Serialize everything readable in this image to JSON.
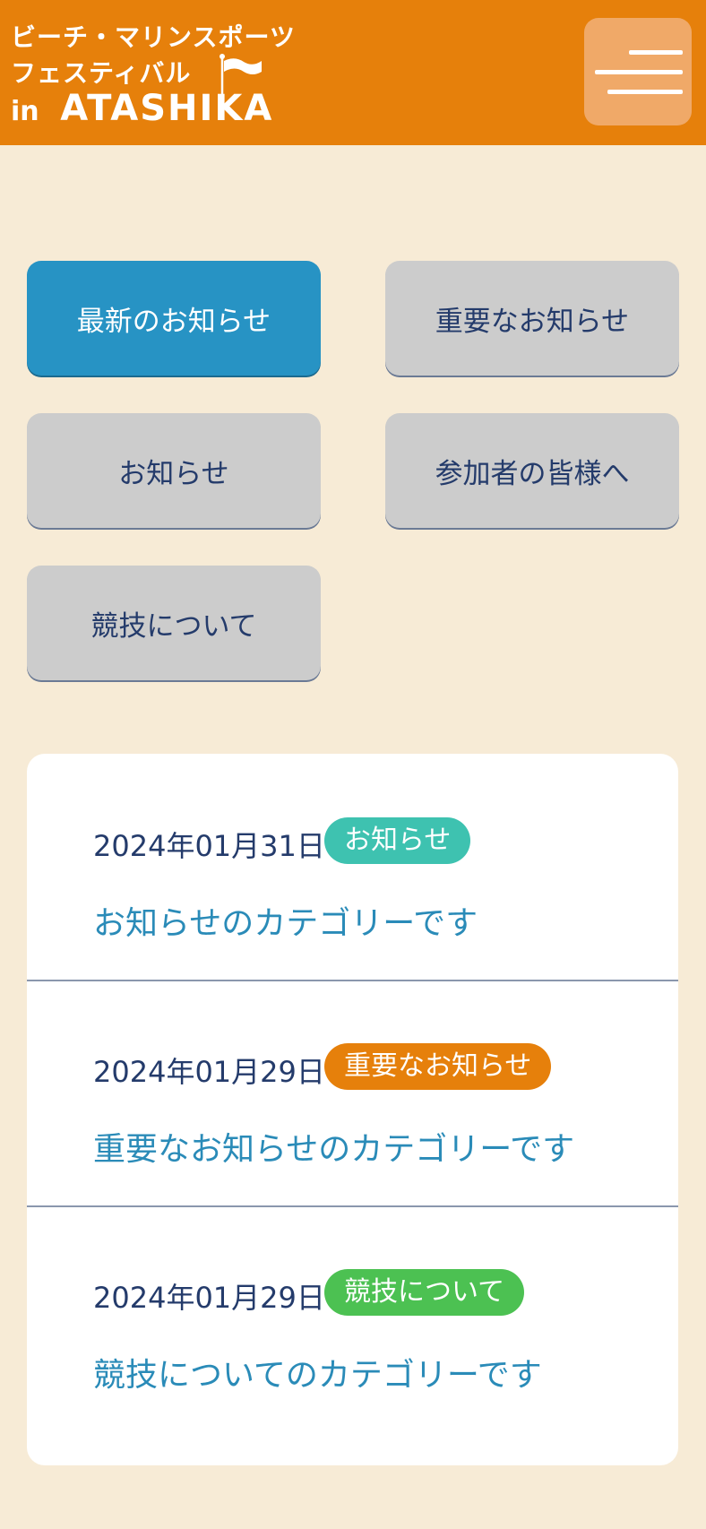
{
  "header": {
    "logo_line1": "ビーチ・マリンスポーツ",
    "logo_line2": "フェスティバル",
    "logo_in": "in",
    "logo_brand": "ATASHIKA",
    "menu_icon": "hamburger-menu-icon",
    "background_color": "#e6800b"
  },
  "filters": [
    {
      "label": "最新のお知らせ",
      "active": true
    },
    {
      "label": "重要なお知らせ",
      "active": false
    },
    {
      "label": "お知らせ",
      "active": false
    },
    {
      "label": "参加者の皆様へ",
      "active": false
    },
    {
      "label": "競技について",
      "active": false
    }
  ],
  "news": [
    {
      "date": "2024年01月31日",
      "badge": "お知らせ",
      "badge_color": "#3ec2b0",
      "title": "お知らせのカテゴリーです"
    },
    {
      "date": "2024年01月29日",
      "badge": "重要なお知らせ",
      "badge_color": "#e6800b",
      "title": "重要なお知らせのカテゴリーです"
    },
    {
      "date": "2024年01月29日",
      "badge": "競技について",
      "badge_color": "#4cc152",
      "title": "競技についてのカテゴリーです"
    }
  ],
  "colors": {
    "page_background": "#f7ebd6",
    "active_filter": "#2793c4",
    "inactive_filter": "#cccccc",
    "text_dark": "#243b6b",
    "link": "#2a8bb8"
  }
}
